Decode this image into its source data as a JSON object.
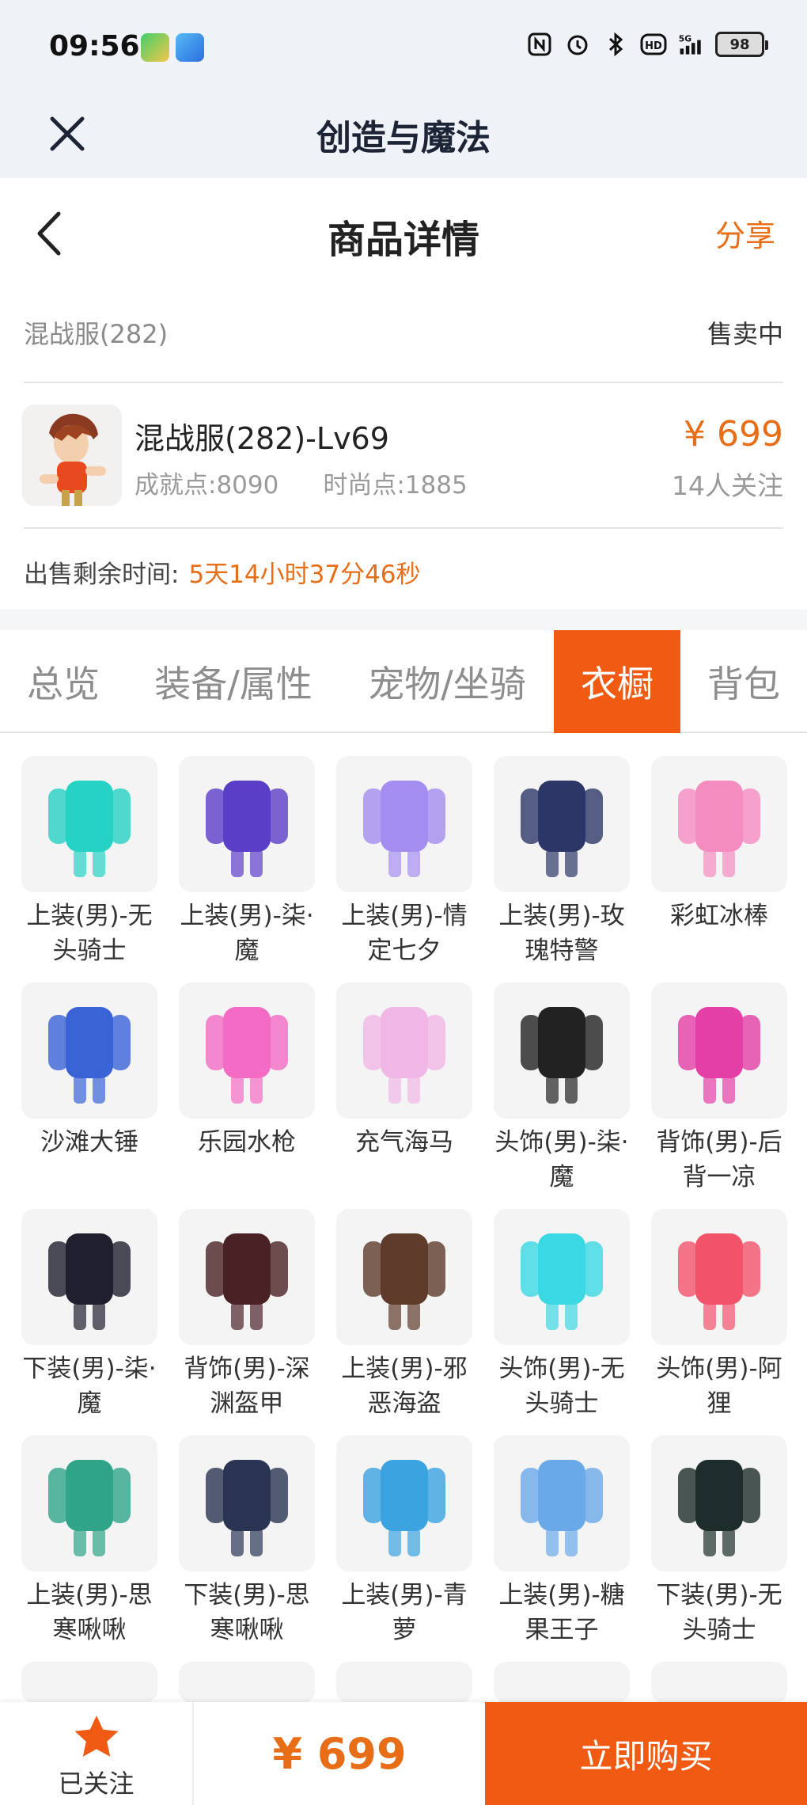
{
  "status_bar": {
    "time": "09:56",
    "battery": "98",
    "icons": [
      "video-app-icon",
      "app-icon",
      "nfc-icon",
      "alarm-icon",
      "bluetooth-icon",
      "hd-icon",
      "signal-5g-icon",
      "battery-icon"
    ]
  },
  "app_bar": {
    "title": "创造与魔法"
  },
  "header": {
    "title": "商品详情",
    "share_label": "分享"
  },
  "server": {
    "name": "混战服(282)",
    "status": "售卖中"
  },
  "item": {
    "name": "混战服(282)-Lv69",
    "achievement": "成就点:8090",
    "fashion": "时尚点:1885",
    "price": "¥ 699",
    "followers": "14人关注"
  },
  "remaining": {
    "label": "出售剩余时间:",
    "value": "5天14小时37分46秒"
  },
  "tabs": [
    {
      "label": "总览",
      "active": false
    },
    {
      "label": "装备/属性",
      "active": false
    },
    {
      "label": "宠物/坐骑",
      "active": false
    },
    {
      "label": "衣橱",
      "active": true
    },
    {
      "label": "背包",
      "active": false
    }
  ],
  "wardrobe": [
    {
      "name": "上装(男)-无头骑士",
      "icon": "armor-top-icon",
      "color": "#25d2c4"
    },
    {
      "name": "上装(男)-柒·魔",
      "icon": "hooded-coat-icon",
      "color": "#5b3ec8"
    },
    {
      "name": "上装(男)-情定七夕",
      "icon": "feather-coat-icon",
      "color": "#a48df0"
    },
    {
      "name": "上装(男)-玫瑰特警",
      "icon": "uniform-icon",
      "color": "#2c3768"
    },
    {
      "name": "彩虹冰棒",
      "icon": "popsicle-icon",
      "color": "#f58cc0"
    },
    {
      "name": "沙滩大锤",
      "icon": "hammer-icon",
      "color": "#3a63d6"
    },
    {
      "name": "乐园水枪",
      "icon": "water-gun-icon",
      "color": "#f36bc4"
    },
    {
      "name": "充气海马",
      "icon": "bow-icon",
      "color": "#f0b7e6"
    },
    {
      "name": "头饰(男)-柒·魔",
      "icon": "hair-icon",
      "color": "#222222"
    },
    {
      "name": "背饰(男)-后背一凉",
      "icon": "ice-cream-icon",
      "color": "#e43fa6"
    },
    {
      "name": "下装(男)-柒·魔",
      "icon": "pants-icon",
      "color": "#1f1f2e"
    },
    {
      "name": "背饰(男)-深渊盔甲",
      "icon": "blade-icon",
      "color": "#4a2226"
    },
    {
      "name": "上装(男)-邪恶海盗",
      "icon": "pirate-coat-icon",
      "color": "#5e3b2a"
    },
    {
      "name": "头饰(男)-无头骑士",
      "icon": "blue-flame-icon",
      "color": "#3ad8e3"
    },
    {
      "name": "头饰(男)-阿狸",
      "icon": "fox-head-icon",
      "color": "#f2536b"
    },
    {
      "name": "上装(男)-思寒啾啾",
      "icon": "hoodie-icon",
      "color": "#2fa489"
    },
    {
      "name": "下装(男)-思寒啾啾",
      "icon": "jeans-icon",
      "color": "#2a3553"
    },
    {
      "name": "上装(男)-青萝",
      "icon": "robe-icon",
      "color": "#3aa3e0"
    },
    {
      "name": "上装(男)-糖果王子",
      "icon": "prince-coat-icon",
      "color": "#6aa9e8"
    },
    {
      "name": "下装(男)-无头骑士",
      "icon": "dark-pants-icon",
      "color": "#1d2d2b"
    }
  ],
  "bottom_bar": {
    "follow_label": "已关注",
    "price": "¥ 699",
    "buy_label": "立即购买"
  }
}
